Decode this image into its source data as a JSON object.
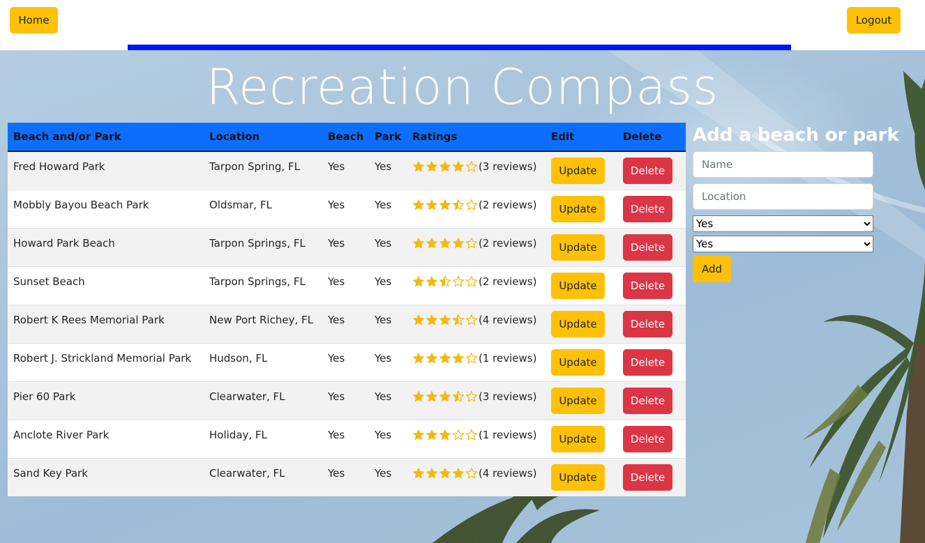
{
  "nav": {
    "home_label": "Home",
    "logout_label": "Logout"
  },
  "site_title": "Recreation Compass",
  "table": {
    "headers": [
      "Beach and/or Park",
      "Location",
      "Beach",
      "Park",
      "Ratings",
      "Edit",
      "Delete"
    ],
    "update_label": "Update",
    "delete_label": "Delete",
    "rows": [
      {
        "name": "Fred Howard Park",
        "location": "Tarpon Spring, FL",
        "beach": "Yes",
        "park": "Yes",
        "rating": 4,
        "reviews": "(3 reviews)"
      },
      {
        "name": "Mobbly Bayou Beach Park",
        "location": "Oldsmar, FL",
        "beach": "Yes",
        "park": "Yes",
        "rating": 3.5,
        "reviews": "(2 reviews)"
      },
      {
        "name": "Howard Park Beach",
        "location": "Tarpon Springs, FL",
        "beach": "Yes",
        "park": "Yes",
        "rating": 4,
        "reviews": "(2 reviews)"
      },
      {
        "name": "Sunset Beach",
        "location": "Tarpon Springs, FL",
        "beach": "Yes",
        "park": "Yes",
        "rating": 2.5,
        "reviews": "(2 reviews)"
      },
      {
        "name": "Robert K Rees Memorial Park",
        "location": "New Port Richey, FL",
        "beach": "Yes",
        "park": "Yes",
        "rating": 3.5,
        "reviews": "(4 reviews)"
      },
      {
        "name": "Robert J. Strickland Memorial Park",
        "location": "Hudson, FL",
        "beach": "Yes",
        "park": "Yes",
        "rating": 4,
        "reviews": "(1 reviews)"
      },
      {
        "name": "Pier 60 Park",
        "location": "Clearwater, FL",
        "beach": "Yes",
        "park": "Yes",
        "rating": 3.5,
        "reviews": "(3 reviews)"
      },
      {
        "name": "Anclote River Park",
        "location": "Holiday, FL",
        "beach": "Yes",
        "park": "Yes",
        "rating": 3,
        "reviews": "(1 reviews)"
      },
      {
        "name": "Sand Key Park",
        "location": "Clearwater, FL",
        "beach": "Yes",
        "park": "Yes",
        "rating": 4,
        "reviews": "(4 reviews)"
      }
    ]
  },
  "add_form": {
    "title": "Add a beach or park",
    "name_placeholder": "Name",
    "location_placeholder": "Location",
    "beach_select_value": "Yes",
    "park_select_value": "Yes",
    "add_label": "Add"
  },
  "colors": {
    "accent_yellow": "#ffc107",
    "danger_red": "#dc3545",
    "header_blue": "#0d6efd",
    "strip_blue": "#0014ff",
    "star_gold": "#f5b80f"
  },
  "icons": {
    "star_full": "star-icon",
    "star_half": "star-half-icon",
    "star_empty": "star-outline-icon"
  }
}
